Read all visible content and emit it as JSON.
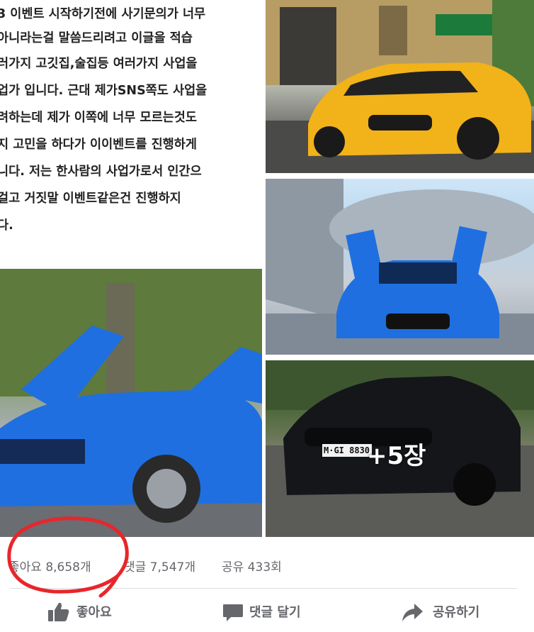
{
  "post": {
    "text_lines": [
      "3 이벤트 시작하기전에 사기문의가 너무",
      "아니라는걸 말씀드리려고 이글을 적습",
      "러가지 고깃집,술집등 여러가지 사업을",
      "업가 입니다. 근대 제가SNS쪽도 사업을",
      "려하는데 제가 이쪽에 너무 모르는것도",
      "지 고민을 하다가 이이벤트를 진행하게",
      "니다. 저는 한사람의 사업가로서 인간으",
      "걸고 거짓말 이벤트같은건 진행하지",
      "다."
    ],
    "photos": {
      "plate_text": "M·GI 8830",
      "more_count": "+5장"
    }
  },
  "stats": {
    "likes": "좋아요 8,658개",
    "comments": "댓글 7,547개",
    "shares": "공유 433회"
  },
  "actions": {
    "like": "좋아요",
    "comment": "댓글 달기",
    "share": "공유하기"
  },
  "colors": {
    "stats_text": "#65676b",
    "annotation_red": "#e8262b",
    "yellow_car": "#f2b21a",
    "blue_car": "#1f6fe0"
  }
}
